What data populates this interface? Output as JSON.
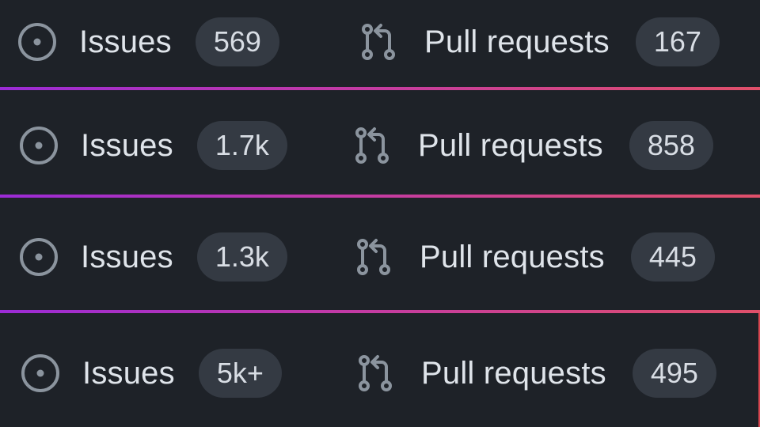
{
  "repos": [
    {
      "issues_label": "Issues",
      "issues_count": "569",
      "pulls_label": "Pull requests",
      "pulls_count": "167"
    },
    {
      "issues_label": "Issues",
      "issues_count": "1.7k",
      "pulls_label": "Pull requests",
      "pulls_count": "858"
    },
    {
      "issues_label": "Issues",
      "issues_count": "1.3k",
      "pulls_label": "Pull requests",
      "pulls_count": "445"
    },
    {
      "issues_label": "Issues",
      "issues_count": "5k+",
      "pulls_label": "Pull requests",
      "pulls_count": "495"
    }
  ],
  "colors": {
    "background": "#1e2228",
    "badge": "#343a43",
    "icon": "#8b949e",
    "divider_start": "#9b2bd6",
    "divider_end": "#e0506a"
  },
  "icons": {
    "issues": "issue-opened-icon",
    "pulls": "git-pull-request-icon"
  }
}
